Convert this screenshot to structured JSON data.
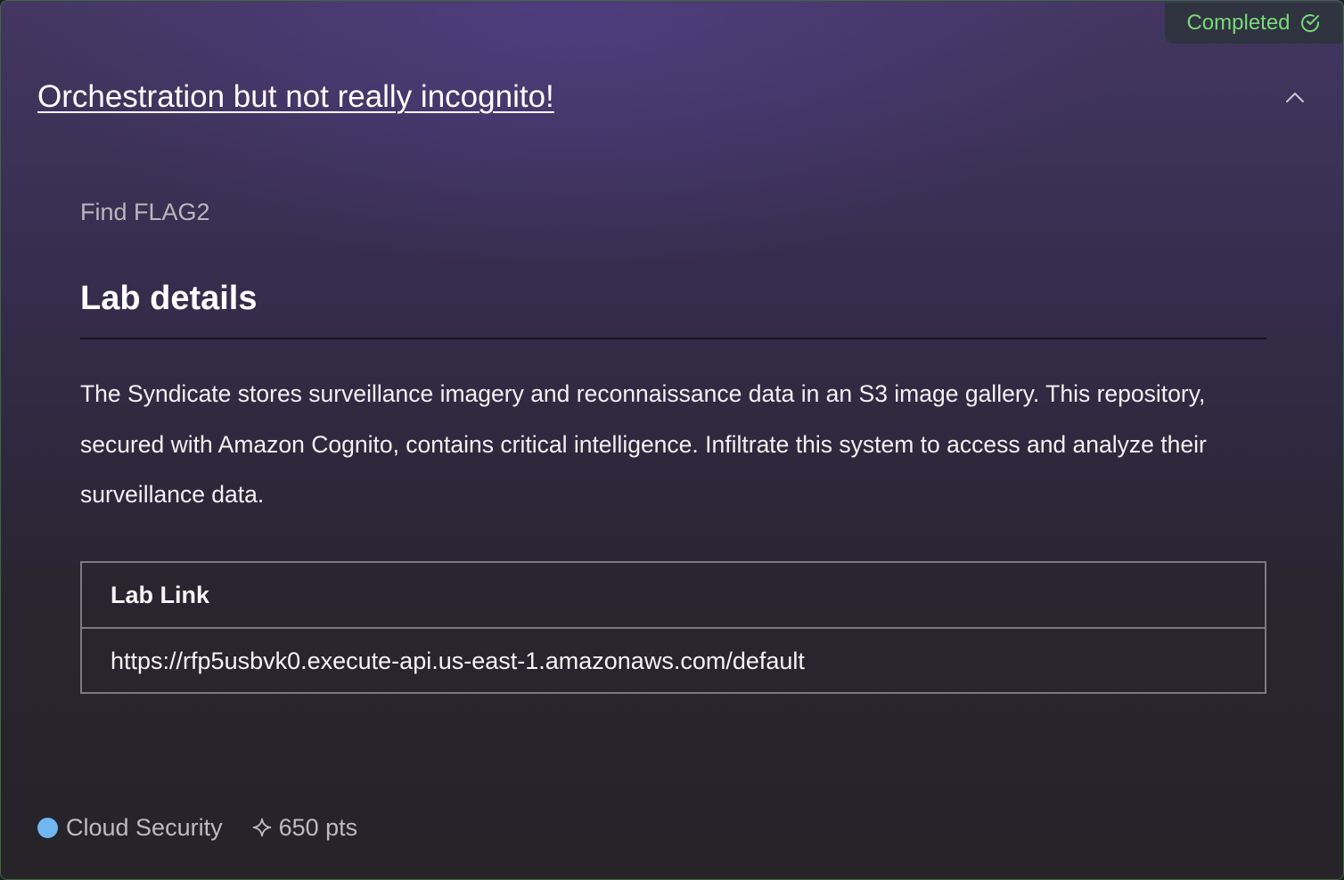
{
  "badge": {
    "label": "Completed",
    "icon": "check-circle-icon",
    "color": "#7bd87a"
  },
  "challenge": {
    "title": "Orchestration but not really incognito!",
    "collapse_icon": "chevron-up-icon",
    "subtitle": "Find FLAG2"
  },
  "lab_details": {
    "heading": "Lab details",
    "description": "The Syndicate stores surveillance imagery and reconnaissance data in an S3 image gallery. This repository, secured with Amazon Cognito, contains critical intelligence. Infiltrate this system to access and analyze their surveillance data.",
    "table": {
      "header": "Lab Link",
      "value": "https://rfp5usbvk0.execute-api.us-east-1.amazonaws.com/default"
    }
  },
  "footer": {
    "category": "Cloud Security",
    "category_color": "#6fb6f2",
    "category_icon": "dot-icon",
    "points": "650 pts",
    "points_icon": "sparkle-icon"
  }
}
